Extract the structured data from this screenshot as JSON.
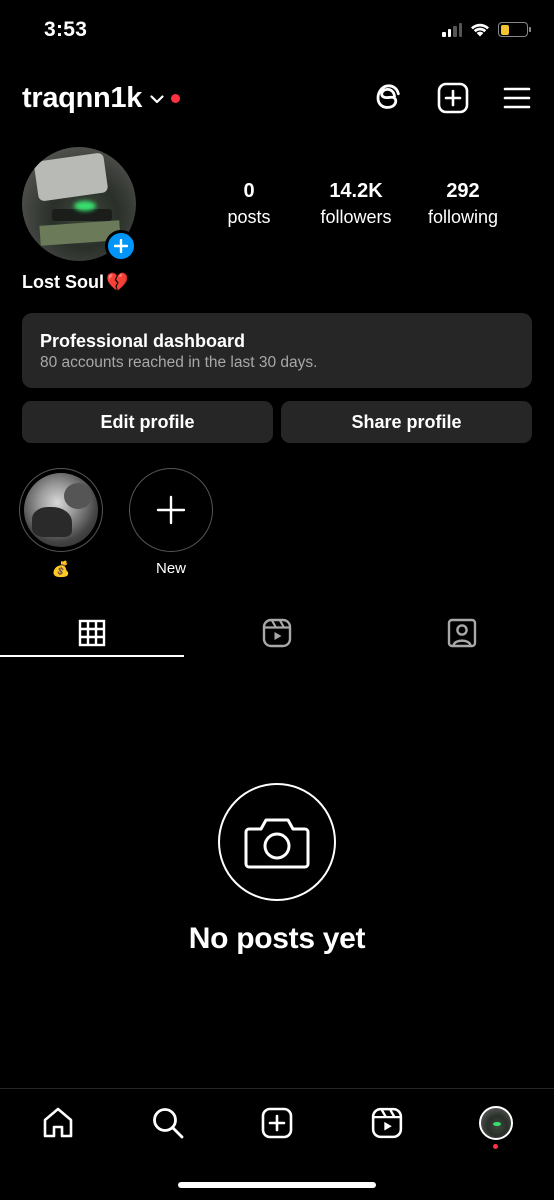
{
  "status_bar": {
    "time": "3:53",
    "battery_color": "#f4c430"
  },
  "profile": {
    "username": "traqnn1k",
    "bio_name": "Lost Soul",
    "bio_emoji": "💔",
    "stats": [
      {
        "value": "0",
        "label": "posts"
      },
      {
        "value": "14.2K",
        "label": "followers"
      },
      {
        "value": "292",
        "label": "following"
      }
    ]
  },
  "dashboard": {
    "title": "Professional dashboard",
    "subtitle": "80 accounts reached in the last 30 days."
  },
  "buttons": {
    "edit": "Edit profile",
    "share": "Share profile"
  },
  "highlights": [
    {
      "label": "💰"
    },
    {
      "label": "New"
    }
  ],
  "tabs": [
    "grid-icon",
    "reels-icon",
    "tagged-icon"
  ],
  "empty_state": {
    "text": "No posts yet"
  },
  "colors": {
    "accent": "#0095f6",
    "notification": "#ff3040",
    "surface": "#262626"
  }
}
